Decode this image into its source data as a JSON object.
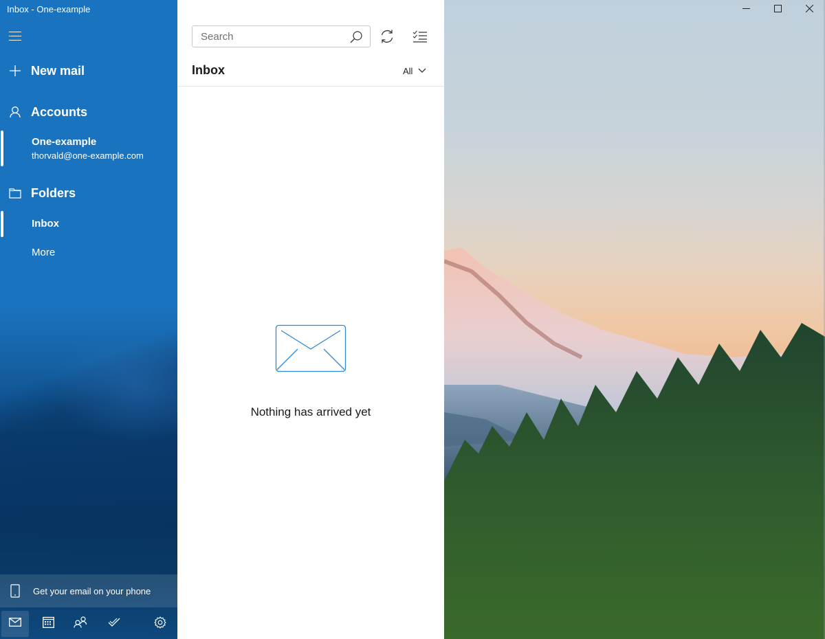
{
  "window": {
    "title": "Inbox - One-example",
    "controls": {
      "minimize": "minimize",
      "maximize": "maximize",
      "close": "close"
    }
  },
  "sidebar": {
    "menu_icon": "hamburger-icon",
    "new_mail_label": "New mail",
    "accounts_label": "Accounts",
    "account": {
      "name": "One-example",
      "email": "thorvald@one-example.com"
    },
    "folders_label": "Folders",
    "folders": [
      {
        "label": "Inbox",
        "selected": true
      },
      {
        "label": "More",
        "selected": false
      }
    ],
    "phone_promo": "Get your email on your phone",
    "bottom_nav": [
      {
        "name": "mail",
        "icon": "mail-icon",
        "active": true
      },
      {
        "name": "calendar",
        "icon": "calendar-icon",
        "active": false
      },
      {
        "name": "people",
        "icon": "people-icon",
        "active": false
      },
      {
        "name": "to-do",
        "icon": "todo-check-icon",
        "active": false
      },
      {
        "name": "settings",
        "icon": "gear-icon",
        "active": false
      }
    ],
    "accent_color": "#1a73be"
  },
  "list": {
    "search_placeholder": "Search",
    "search_value": "",
    "folder_title": "Inbox",
    "filter_value": "All",
    "empty_message": "Nothing has arrived yet",
    "empty_icon_color": "#2b88d8"
  }
}
